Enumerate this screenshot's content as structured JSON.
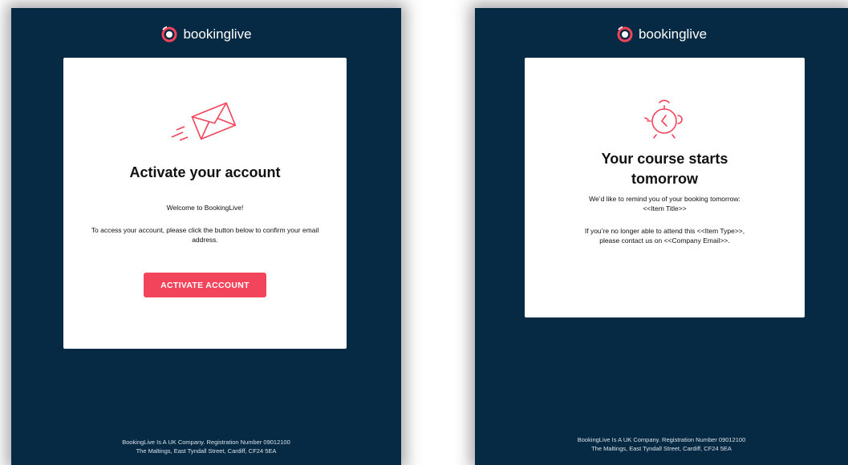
{
  "left_email": {
    "logo_text": "bookinglive",
    "title": "Activate your account",
    "welcome": "Welcome to BookingLive!",
    "instructions": "To access your account, please click the button below to confirm your email address.",
    "button_label": "ACTIVATE ACCOUNT",
    "footer_line1": "BookingLive Is A UK Company. Registration Number 09012100",
    "footer_line2": "The Maltings, East Tyndall Street, Cardiff, CF24 5EA"
  },
  "right_email": {
    "logo_text": "bookinglive",
    "title": "Your course starts tomorrow",
    "remind_line1": "We’d like to remind you of your booking tomorrow:",
    "remind_line2": "<<Item Title>>",
    "contact_line1": "If you’re no longer able to attend this <<Item Type>>,",
    "contact_line2": "please contact us on <<Company Email>>.",
    "footer_line1": "BookingLive Is A UK Company. Registration Number 09012100",
    "footer_line2": "The Maltings, East Tyndall Street, Cardiff, CF24 5EA"
  },
  "colors": {
    "background_navy": "#072a44",
    "accent_red": "#f2445a",
    "card_white": "#ffffff"
  },
  "icons": {
    "logo": "bookinglive-logo-icon",
    "left_illustration": "envelope-icon",
    "right_illustration": "alarm-clock-icon"
  }
}
